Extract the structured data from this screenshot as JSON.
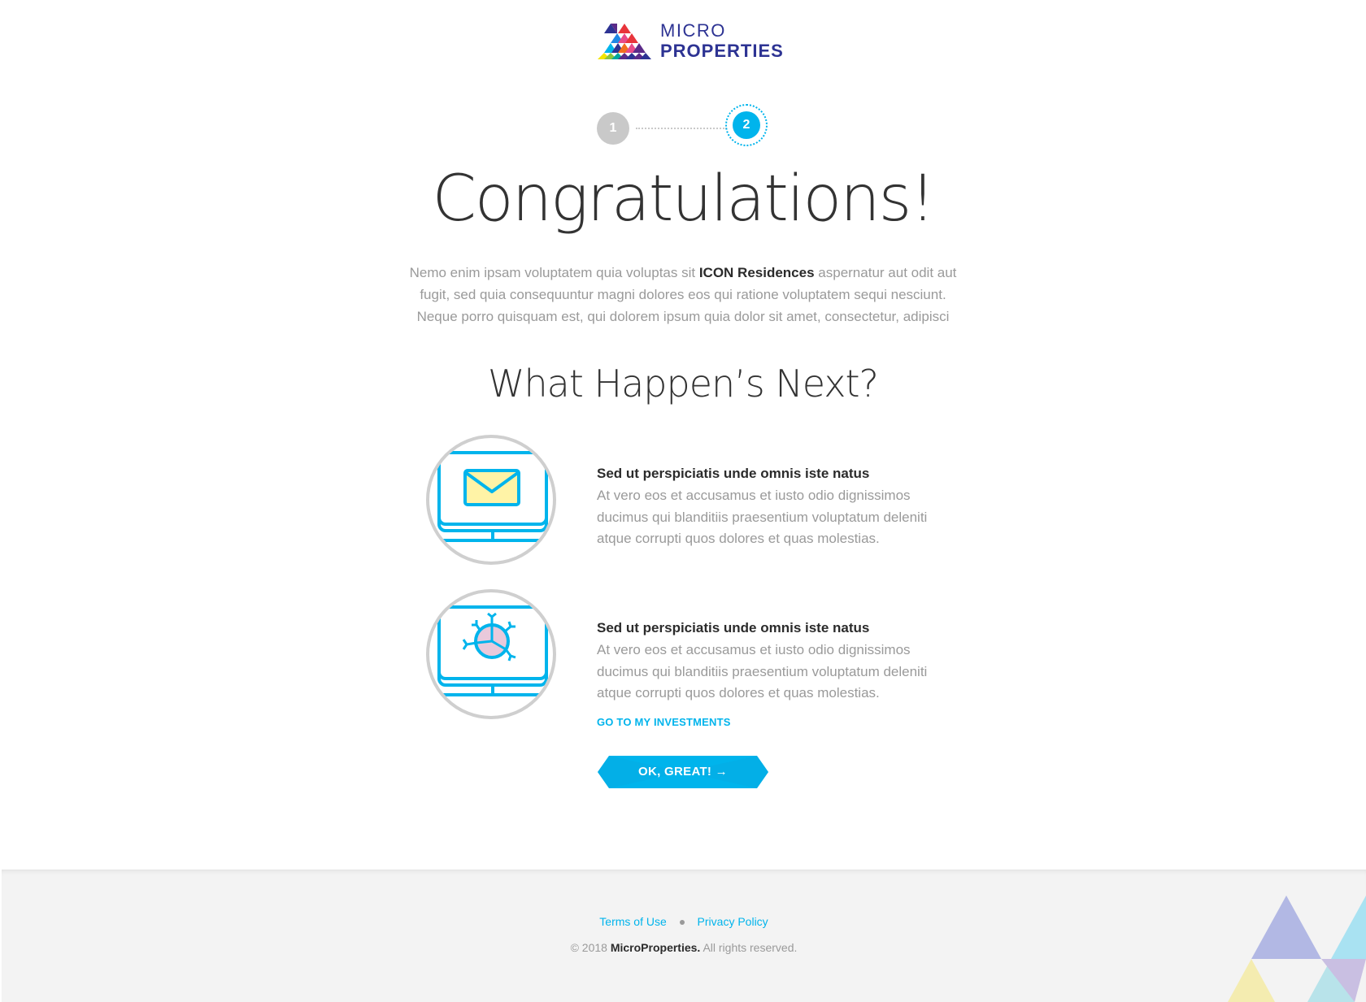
{
  "brand": {
    "line1": "MICRO",
    "line2": "PROPERTIES",
    "color": "#2d3393"
  },
  "stepper": {
    "step1": "1",
    "step2": "2",
    "current": 2,
    "total": 2
  },
  "hero": {
    "title": "Congratulations!",
    "intro_before": "Nemo enim ipsam voluptatem quia voluptas sit ",
    "intro_highlight": "ICON Residences",
    "intro_after": " aspernatur aut odit aut fugit, sed quia consequuntur magni dolores eos qui ratione voluptatem sequi nesciunt. Neque porro quisquam est, qui dolorem ipsum quia dolor sit amet, consectetur, adipisci"
  },
  "next": {
    "title": "What Happen’s Next?",
    "items": [
      {
        "icon": "monitor-mail-icon",
        "heading": "Sed ut perspiciatis unde omnis iste natus",
        "body": "At vero eos et accusamus et iusto odio dignissimos ducimus qui blanditiis praesentium voluptatum deleniti atque corrupti quos dolores et quas molestias."
      },
      {
        "icon": "monitor-network-icon",
        "heading": "Sed ut perspiciatis unde omnis iste natus",
        "body": "At vero eos et accusamus et iusto odio dignissimos ducimus qui blanditiis praesentium voluptatum deleniti atque corrupti quos dolores et quas molestias.",
        "link": "GO TO MY INVESTMENTS"
      }
    ]
  },
  "cta": {
    "label": "OK, GREAT! →",
    "color": "#00b4ec"
  },
  "footer": {
    "terms": "Terms of Use",
    "privacy": "Privacy Policy",
    "copyright_prefix": "© 2018 ",
    "copyright_brand": "MicroProperties.",
    "copyright_suffix": " All rights reserved."
  },
  "colors": {
    "accent": "#00b4ec",
    "muted": "#9a9a9a",
    "footer_bg": "#f3f3f3"
  }
}
